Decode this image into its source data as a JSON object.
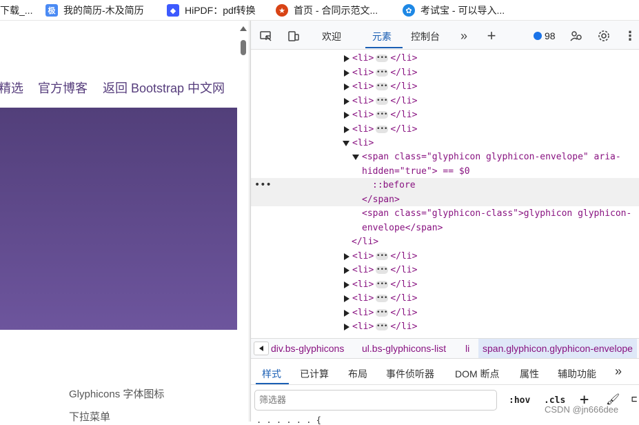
{
  "bookmarks": [
    {
      "label": "下载_..."
    },
    {
      "label": "我的简历-木及简历"
    },
    {
      "label": "HiPDF：pdf转换"
    },
    {
      "label": "首页 - 合同示范文..."
    },
    {
      "label": "考试宝 - 可以导入..."
    }
  ],
  "page": {
    "nav": [
      "精选",
      "官方博客",
      "返回 Bootstrap 中文网"
    ],
    "sidelinks": [
      "Glyphicons 字体图标",
      "下拉菜单"
    ]
  },
  "devtools": {
    "tabs": [
      "欢迎",
      "元素",
      "控制台"
    ],
    "active_tab": "元素",
    "issues_count": "98",
    "tree": {
      "li_collapsed_before": [
        "<li>",
        "</li>"
      ],
      "li_open": "<li>",
      "span_open_1": "<span class=\"glyphicon glyphicon-envelope\" aria-",
      "span_open_2": "hidden=\"true\"> == $0",
      "before": "::before",
      "span_close": "</span>",
      "span2_line1": "<span class=\"glyphicon-class\">glyphicon glyphicon-",
      "span2_line2": "envelope</span>",
      "li_close": "</li>"
    },
    "breadcrumbs": [
      "div.bs-glyphicons",
      "ul.bs-glyphicons-list",
      "li",
      "span.glyphicon.glyphicon-envelope"
    ],
    "styles_tabs": [
      "样式",
      "已计算",
      "布局",
      "事件侦听器",
      "DOM 断点",
      "属性",
      "辅助功能"
    ],
    "filter_placeholder": "筛选器",
    "hov": ":hov",
    "cls": ".cls"
  },
  "watermark": "CSDN @jn666dee",
  "colors": {
    "accent": "#1a5fb4",
    "hero_top": "#523f7a",
    "hero_bottom": "#6d559d",
    "tag": "#881280"
  }
}
